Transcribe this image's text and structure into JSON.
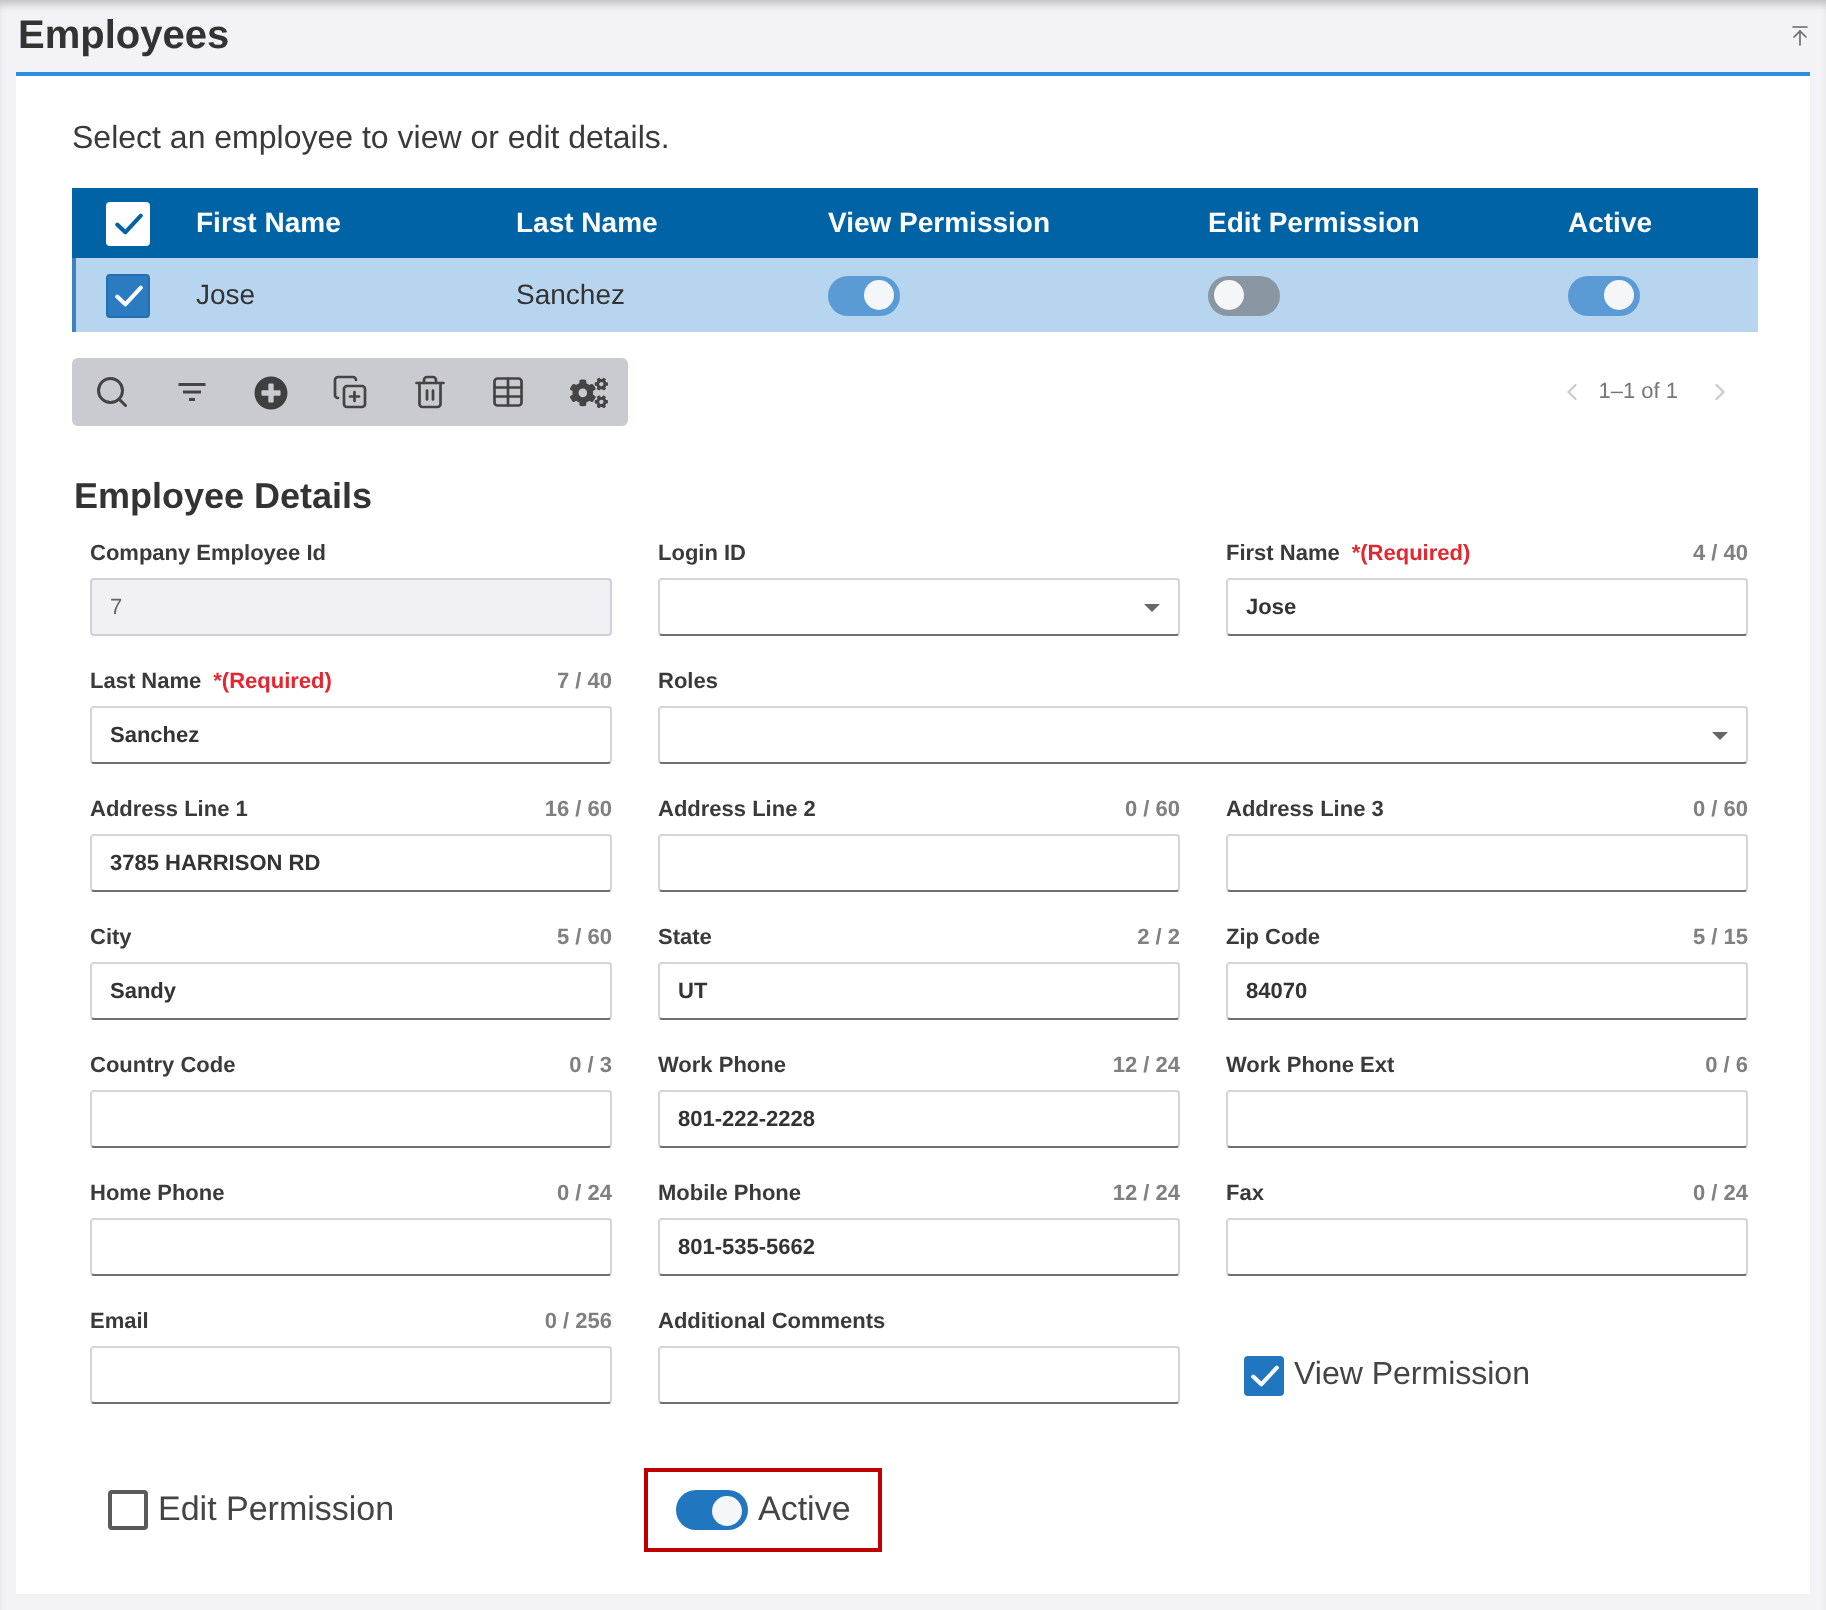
{
  "header": {
    "title": "Employees"
  },
  "intro": "Select an employee to view or edit details.",
  "table": {
    "all_selected": true,
    "columns": [
      "First Name",
      "Last Name",
      "View Permission",
      "Edit Permission",
      "Active"
    ],
    "rows": [
      {
        "selected": true,
        "cells": [
          {
            "kind": "text",
            "text": "Jose"
          },
          {
            "kind": "text",
            "text": "Sanchez"
          },
          {
            "kind": "toggle",
            "on": true
          },
          {
            "kind": "toggle",
            "on": false
          },
          {
            "kind": "toggle",
            "on": true
          }
        ]
      }
    ]
  },
  "pagination": {
    "range": "1–1 of 1",
    "previous": {
      "disabled": true
    },
    "next": {
      "disabled": true
    }
  },
  "details": {
    "title": "Employee Details",
    "rows": [
      [
        {
          "kind": "text",
          "label": "Company Employee Id",
          "value": "7",
          "disabled": true
        },
        {
          "kind": "select",
          "label": "Login ID",
          "disabled": false
        },
        {
          "kind": "text",
          "label": "First Name",
          "required_note": "*(Required)",
          "counter": "4 / 40",
          "value": "Jose",
          "disabled": false
        }
      ],
      [
        {
          "kind": "text",
          "label": "Last Name",
          "required_note": "*(Required)",
          "counter": "7 / 40",
          "value": "Sanchez",
          "disabled": false
        },
        {
          "kind": "select",
          "label": "Roles",
          "disabled": false
        }
      ],
      [
        {
          "kind": "text",
          "label": "Address Line 1",
          "counter": "16 / 60",
          "value": "3785 HARRISON RD",
          "disabled": false
        },
        {
          "kind": "text",
          "label": "Address Line 2",
          "counter": "0 / 60",
          "disabled": false
        },
        {
          "kind": "text",
          "label": "Address Line 3",
          "counter": "0 / 60",
          "disabled": false
        }
      ],
      [
        {
          "kind": "text",
          "label": "City",
          "counter": "5 / 60",
          "value": "Sandy",
          "disabled": false
        },
        {
          "kind": "text",
          "label": "State",
          "counter": "2 / 2",
          "value": "UT",
          "disabled": false
        },
        {
          "kind": "text",
          "label": "Zip Code",
          "counter": "5 / 15",
          "value": "84070",
          "disabled": false
        }
      ],
      [
        {
          "kind": "text",
          "label": "Country Code",
          "counter": "0 / 3",
          "disabled": false
        },
        {
          "kind": "text",
          "label": "Work Phone",
          "counter": "12 / 24",
          "value": "801-222-2228",
          "disabled": false
        },
        {
          "kind": "text",
          "label": "Work Phone Ext",
          "counter": "0 / 6",
          "disabled": false
        }
      ],
      [
        {
          "kind": "text",
          "label": "Home Phone",
          "counter": "0 / 24",
          "disabled": false
        },
        {
          "kind": "text",
          "label": "Mobile Phone",
          "counter": "12 / 24",
          "value": "801-535-5662",
          "disabled": false
        },
        {
          "kind": "text",
          "label": "Fax",
          "counter": "0 / 24",
          "disabled": false
        }
      ],
      [
        {
          "kind": "text",
          "label": "Email",
          "counter": "0 / 256",
          "disabled": false
        },
        {
          "kind": "text",
          "label": "Additional Comments",
          "disabled": false
        },
        {
          "kind": "checkbox",
          "label": "View Permission",
          "checked": true
        }
      ]
    ],
    "controls": [
      {
        "kind": "checkbox",
        "label": "Edit Permission",
        "checked": false,
        "highlighted": false
      },
      {
        "kind": "toggle",
        "label": "Active",
        "on": true,
        "highlighted": true
      }
    ]
  }
}
